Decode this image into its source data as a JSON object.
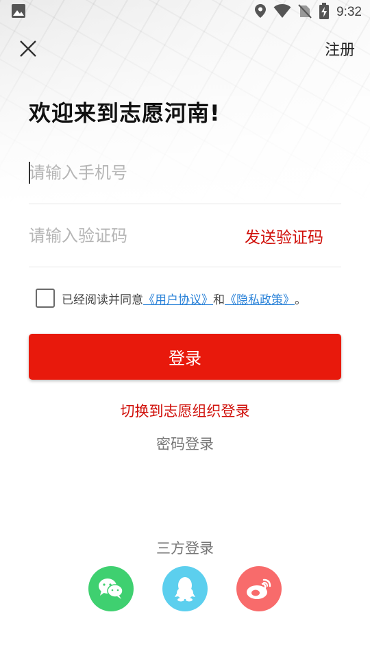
{
  "status_bar": {
    "time": "9:32",
    "icons": [
      "image-icon",
      "location-icon",
      "wifi-icon",
      "no-sim-icon",
      "battery-charging-icon"
    ]
  },
  "topbar": {
    "close_icon": "close-icon",
    "register_label": "注册"
  },
  "title": "欢迎来到志愿河南!",
  "phone_field": {
    "value": "",
    "placeholder": "请输入手机号"
  },
  "code_field": {
    "value": "",
    "placeholder": "请输入验证码",
    "send_label": "发送验证码"
  },
  "agreement": {
    "checked": false,
    "prefix": "已经阅读并同意",
    "user_agreement": "《用户协议》",
    "and": "和",
    "privacy_policy": "《隐私政策》",
    "suffix": "。"
  },
  "login_button": "登录",
  "switch_org_login": "切换到志愿组织登录",
  "password_login": "密码登录",
  "third_party": {
    "title": "三方登录",
    "items": [
      {
        "icon": "wechat-icon",
        "color": "#3fd070"
      },
      {
        "icon": "qq-icon",
        "color": "#5ccfee"
      },
      {
        "icon": "weibo-icon",
        "color": "#f86b6b"
      }
    ]
  },
  "colors": {
    "accent": "#e8190c",
    "link": "#2a82d8",
    "red_text": "#d0100a"
  }
}
